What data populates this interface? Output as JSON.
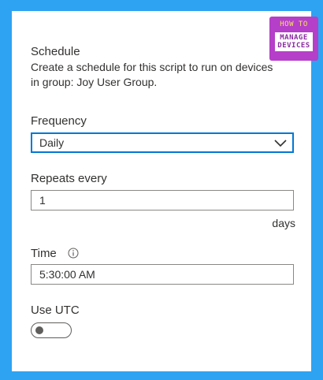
{
  "logo": {
    "line1": "HOW TO",
    "line2": "MANAGE",
    "line3": "DEVICES"
  },
  "schedule": {
    "heading": "Schedule",
    "description": "Create a schedule for this script to run on devices in group: Joy User Group."
  },
  "frequency": {
    "label": "Frequency",
    "selected": "Daily",
    "icon": "chevron-down-icon"
  },
  "repeats": {
    "label": "Repeats every",
    "value": "1",
    "suffix": "days"
  },
  "time": {
    "label": "Time",
    "value": "5:30:00 AM",
    "icon": "info-icon"
  },
  "utc": {
    "label": "Use UTC",
    "state": "off"
  },
  "colors": {
    "background": "#2ea3f2",
    "accent": "#0078d4"
  }
}
